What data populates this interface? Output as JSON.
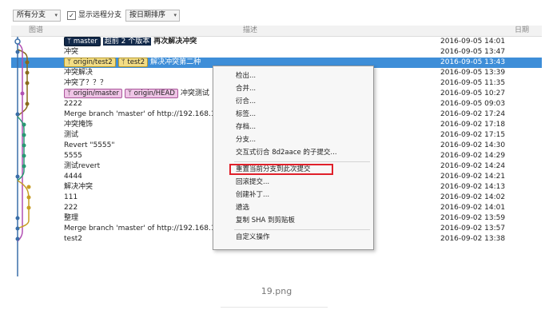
{
  "toolbar": {
    "branch_select": "所有分支",
    "show_remote_label": "显示远程分支",
    "sort_select": "按日期排序"
  },
  "columns": {
    "graph": "图谱",
    "description": "描述",
    "date": "日期"
  },
  "commits": [
    {
      "tags": [
        {
          "text": "master",
          "style": "local"
        }
      ],
      "ahead": "超前 2 个版本",
      "text": "再次解决冲突",
      "bold": true,
      "date": "2016-09-05 14:01"
    },
    {
      "tags": [],
      "text": "冲突",
      "date": "2016-09-05 13:47"
    },
    {
      "tags": [
        {
          "text": "origin/test2",
          "style": "yellow"
        },
        {
          "text": "test2",
          "style": "yellow"
        }
      ],
      "text": "解决冲突第二种",
      "date": "2016-09-05 13:43",
      "selected": true
    },
    {
      "tags": [],
      "text": "冲突解决",
      "date": "2016-09-05 13:39"
    },
    {
      "tags": [],
      "text": "冲突了？？？",
      "date": "2016-09-05 11:35"
    },
    {
      "tags": [
        {
          "text": "origin/master",
          "style": "pink"
        },
        {
          "text": "origin/HEAD",
          "style": "pink"
        }
      ],
      "text": "冲突测试",
      "date": "2016-09-05 10:27"
    },
    {
      "tags": [],
      "text": "2222",
      "date": "2016-09-05 09:03"
    },
    {
      "tags": [],
      "text": "Merge branch 'master' of http://192.168.1",
      "date": "2016-09-02 17:24"
    },
    {
      "tags": [],
      "text": "冲突掩饰",
      "date": "2016-09-02 17:18"
    },
    {
      "tags": [],
      "text": "测试",
      "date": "2016-09-02 17:15"
    },
    {
      "tags": [],
      "text": "Revert \"5555\"",
      "date": "2016-09-02 14:30"
    },
    {
      "tags": [],
      "text": "5555",
      "date": "2016-09-02 14:29"
    },
    {
      "tags": [],
      "text": "测试revert",
      "date": "2016-09-02 14:24"
    },
    {
      "tags": [],
      "text": "4444",
      "date": "2016-09-02 14:21"
    },
    {
      "tags": [],
      "text": "解决冲突",
      "date": "2016-09-02 14:13"
    },
    {
      "tags": [],
      "text": "111",
      "date": "2016-09-02 14:02"
    },
    {
      "tags": [],
      "text": "222",
      "date": "2016-09-02 14:01"
    },
    {
      "tags": [],
      "text": "整理",
      "date": "2016-09-02 13:59"
    },
    {
      "tags": [],
      "text": "Merge branch 'master' of http://192.168.100.89:7070/r/test",
      "date": "2016-09-02 13:57"
    },
    {
      "tags": [],
      "text": "test2",
      "date": "2016-09-02 13:38"
    }
  ],
  "context_menu": {
    "items": [
      "检出...",
      "合并...",
      "衍合...",
      "标签...",
      "存档...",
      "分支...",
      "交互式衍合 8d2aace 的子提交...",
      "重置当前分支到此次提交",
      "回滚提交...",
      "创建补丁...",
      "遴选",
      "复制 SHA 到剪贴板",
      "自定义操作"
    ],
    "highlighted_index": 7
  },
  "caption": "19.png",
  "colors": {
    "selected_row": "#3e8ed8",
    "highlight_box": "#e0202a",
    "local_tag": "#12294a",
    "remote_tag_yellow": "#f3dd84",
    "remote_tag_pink": "#efc4e6"
  },
  "icons": {
    "dropdown": "chevron-down-icon",
    "checkbox": "checkbox-checked-icon",
    "tag": "branch-tag-icon"
  }
}
